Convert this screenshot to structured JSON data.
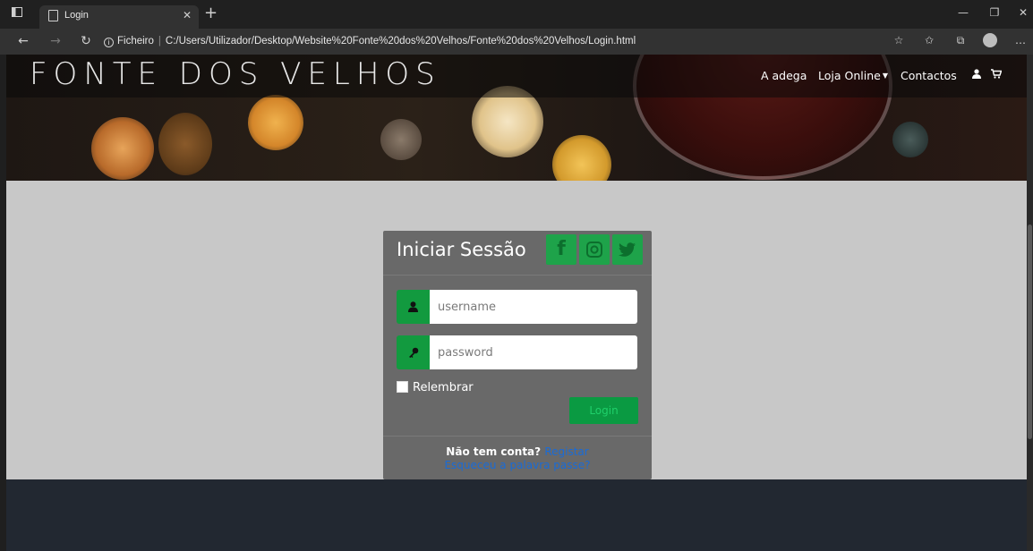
{
  "browser": {
    "tab_title": "Login",
    "address_prefix": "Ficheiro",
    "address_url": "C:/Users/Utilizador/Desktop/Website%20Fonte%20dos%20Velhos/Fonte%20dos%20Velhos/Login.html"
  },
  "site": {
    "logo": "FONTE DOS VELHOS",
    "nav": {
      "adega": "A adega",
      "loja": "Loja Online",
      "contactos": "Contactos"
    }
  },
  "login": {
    "title": "Iniciar Sessão",
    "username_placeholder": "username",
    "password_placeholder": "password",
    "remember_label": "Relembrar",
    "login_button": "Login",
    "no_account": "Não tem conta?",
    "register_link": "Registar",
    "forgot_link": "Esqueceu a palavra passe?"
  },
  "colors": {
    "accent_green": "#129a3f",
    "card_bg": "#696969",
    "page_bg": "#c8c8c8",
    "footer_bg": "#222831",
    "link_blue": "#1a6bd6"
  },
  "icons": {
    "facebook": "facebook-icon",
    "instagram": "instagram-icon",
    "twitter": "twitter-icon",
    "user": "user-icon",
    "key": "key-icon",
    "cart": "cart-icon"
  }
}
